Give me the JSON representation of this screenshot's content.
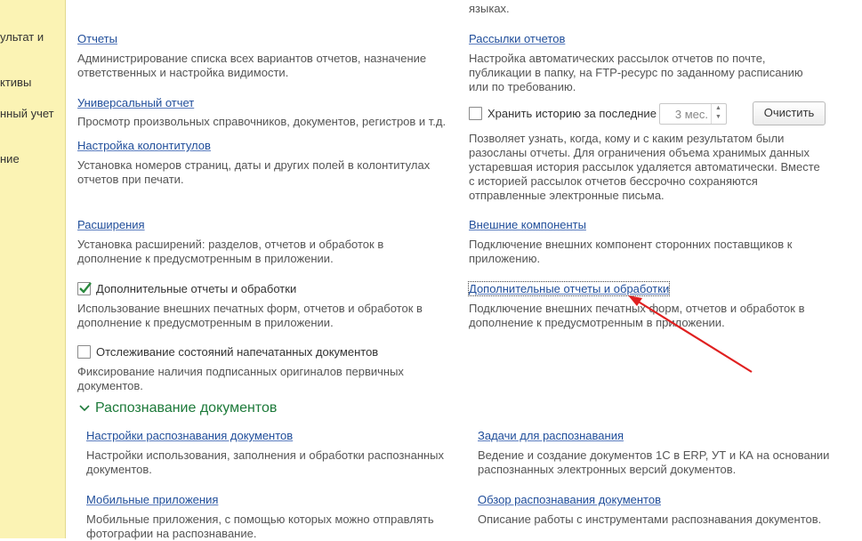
{
  "sidebar": {
    "items": [
      {
        "label": "ультат и"
      },
      {
        "label": "ктивы"
      },
      {
        "label": "нный учет"
      },
      {
        "label": "ние"
      }
    ]
  },
  "top_cut": {
    "right_text": "языках."
  },
  "left": {
    "reports": {
      "title": "Отчеты",
      "desc": [
        "Администрирование списка всех вариантов отчетов, назначение",
        "ответственных и настройка видимости."
      ]
    },
    "universal": {
      "title": "Универсальный отчет",
      "desc": [
        "Просмотр произвольных справочников, документов, регистров и т.д."
      ]
    },
    "headers": {
      "title": "Настройка колонтитулов",
      "desc": [
        "Установка номеров страниц, даты и других полей в колонтитулах",
        "отчетов при печати."
      ]
    },
    "extensions": {
      "title": "Расширения",
      "desc": [
        "Установка расширений: разделов, отчетов и обработок в",
        "дополнение к предусмотренным в приложении."
      ]
    },
    "additional_cb": {
      "label": "Дополнительные отчеты и обработки",
      "checked": true,
      "desc": [
        "Использование внешних печатных форм, отчетов и обработок в",
        "дополнение к предусмотренным в приложении."
      ]
    },
    "tracking_cb": {
      "label": "Отслеживание состояний напечатанных документов",
      "checked": false,
      "desc": [
        "Фиксирование наличия подписанных оригиналов первичных",
        "документов."
      ]
    }
  },
  "right": {
    "mailings": {
      "title": "Рассылки отчетов",
      "desc": [
        "Настройка автоматических рассылок отчетов по почте,",
        "публикации в папку, на FTP-ресурс по заданному расписанию",
        "или по требованию."
      ]
    },
    "history": {
      "label": "Хранить историю за последние",
      "value": "3 мес.",
      "clear_button": "Очистить",
      "checked": false,
      "desc": [
        "Позволяет узнать, когда, кому и с каким результатом были",
        "разосланы отчеты. Для ограничения объема хранимых данных",
        "устаревшая история рассылок удаляется автоматически. Вместе",
        "с историей рассылок отчетов бессрочно сохраняются",
        "отправленные электронные письма."
      ]
    },
    "ext_components": {
      "title": "Внешние компоненты",
      "desc": [
        "Подключение внешних компонент сторонних поставщиков к",
        "приложению."
      ]
    },
    "additional_link": {
      "title": "Дополнительные отчеты и обработки",
      "desc": [
        "Подключение внешних печатных форм, отчетов и обработок в",
        "дополнение к предусмотренным в приложении."
      ]
    }
  },
  "recognition": {
    "heading": "Распознавание документов",
    "settings": {
      "title": "Настройки распознавания документов",
      "desc": [
        "Настройки использования, заполнения и обработки распознанных",
        "документов."
      ]
    },
    "tasks": {
      "title": "Задачи для распознавания",
      "desc": [
        "Ведение и создание документов 1С в ERP, УТ и КА на основании",
        "распознанных электронных версий документов."
      ]
    },
    "mobile": {
      "title": "Мобильные приложения",
      "desc": [
        "Мобильные приложения, с помощью которых можно отправлять",
        "фотографии на распознавание."
      ]
    },
    "overview": {
      "title": "Обзор распознавания документов",
      "desc": [
        "Описание работы с инструментами распознавания документов."
      ]
    }
  },
  "colors": {
    "sidebar": "#fbf3b4",
    "link": "#1f4d9a",
    "section": "#1d7a3a",
    "arrow": "#e02020",
    "check": "#2a8a3e"
  }
}
